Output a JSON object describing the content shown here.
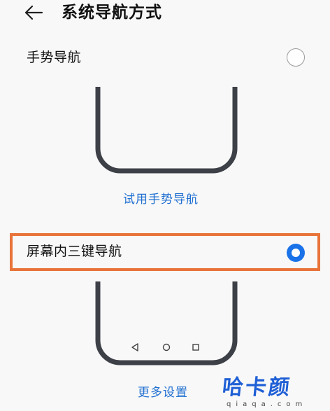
{
  "header": {
    "title": "系统导航方式",
    "back_icon": "arrow-left-icon"
  },
  "options": {
    "gesture": {
      "label": "手势导航",
      "selected": false
    },
    "three_key": {
      "label": "屏幕内三键导航",
      "selected": true,
      "highlight_color": "#e8743b"
    }
  },
  "links": {
    "try_gesture": "试用手势导航",
    "more_settings": "更多设置"
  },
  "nav_bar_icons": [
    "back-triangle-icon",
    "home-circle-icon",
    "recent-square-icon"
  ],
  "watermark": {
    "mark": "哈卡颜",
    "domain": "qiaqa.com"
  },
  "colors": {
    "accent": "#1f6fd1",
    "radio_selected": "#1a72e8",
    "phone_outline": "#3e4048"
  }
}
